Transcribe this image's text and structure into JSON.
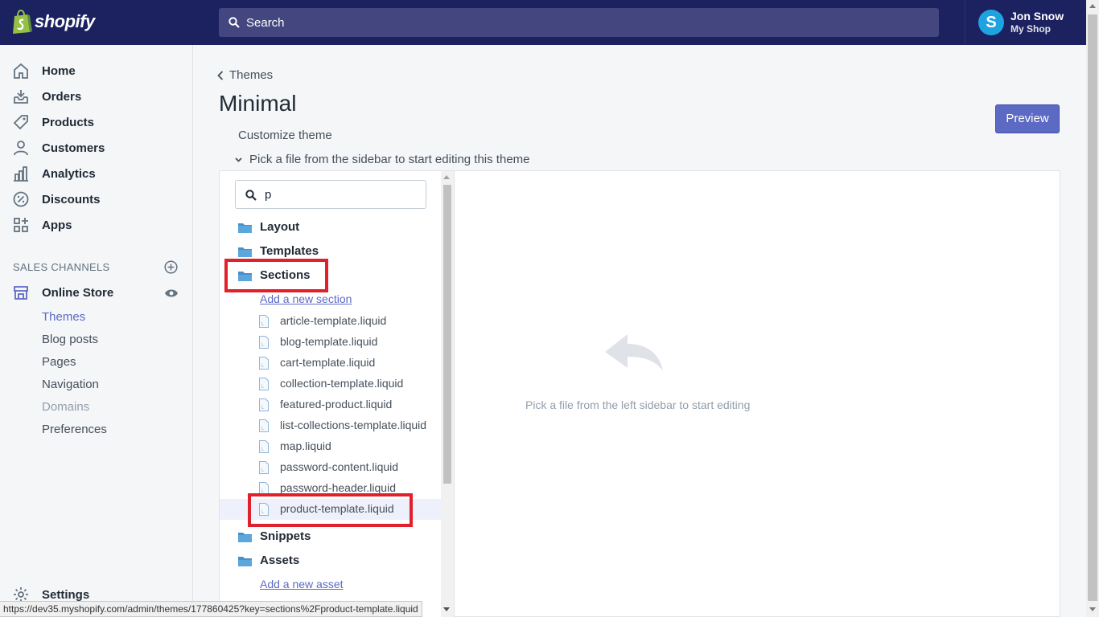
{
  "topbar": {
    "logo_text": "shopify",
    "search_placeholder": "Search",
    "user_name": "Jon Snow",
    "shop_name": "My Shop",
    "avatar_letter": "S"
  },
  "sidebar": {
    "items": [
      {
        "label": "Home",
        "icon": "home-icon"
      },
      {
        "label": "Orders",
        "icon": "orders-icon"
      },
      {
        "label": "Products",
        "icon": "tag-icon"
      },
      {
        "label": "Customers",
        "icon": "person-icon"
      },
      {
        "label": "Analytics",
        "icon": "bar-chart-icon"
      },
      {
        "label": "Discounts",
        "icon": "discount-icon"
      },
      {
        "label": "Apps",
        "icon": "apps-icon"
      }
    ],
    "sales_channels_label": "SALES CHANNELS",
    "online_store_label": "Online Store",
    "online_store_subitems": [
      {
        "label": "Themes",
        "state": "active"
      },
      {
        "label": "Blog posts",
        "state": "normal"
      },
      {
        "label": "Pages",
        "state": "normal"
      },
      {
        "label": "Navigation",
        "state": "normal"
      },
      {
        "label": "Domains",
        "state": "disabled"
      },
      {
        "label": "Preferences",
        "state": "normal"
      }
    ],
    "settings_label": "Settings"
  },
  "main": {
    "back_label": "Themes",
    "title": "Minimal",
    "preview_label": "Preview",
    "customize_label": "Customize theme",
    "pick_hint": "Pick a file from the sidebar to start editing this theme",
    "filter_value": "p",
    "folders": {
      "layout": "Layout",
      "templates": "Templates",
      "sections": "Sections",
      "snippets": "Snippets",
      "assets": "Assets"
    },
    "add_section_label": "Add a new section",
    "add_asset_label": "Add a new asset",
    "section_files": [
      "article-template.liquid",
      "blog-template.liquid",
      "cart-template.liquid",
      "collection-template.liquid",
      "featured-product.liquid",
      "list-collections-template.liquid",
      "map.liquid",
      "password-content.liquid",
      "password-header.liquid",
      "product-template.liquid"
    ],
    "selected_file": "product-template.liquid",
    "empty_state_text": "Pick a file from the left sidebar to start editing"
  },
  "status_bar_url": "https://dev35.myshopify.com/admin/themes/177860425?key=sections%2Fproduct-template.liquid",
  "colors": {
    "topbar_bg": "#1c2260",
    "search_bg": "#43467f",
    "accent": "#5c6ac4",
    "highlight_box": "#e0202a",
    "avatar": "#1fa3e0",
    "folder": "#4a90c7"
  }
}
